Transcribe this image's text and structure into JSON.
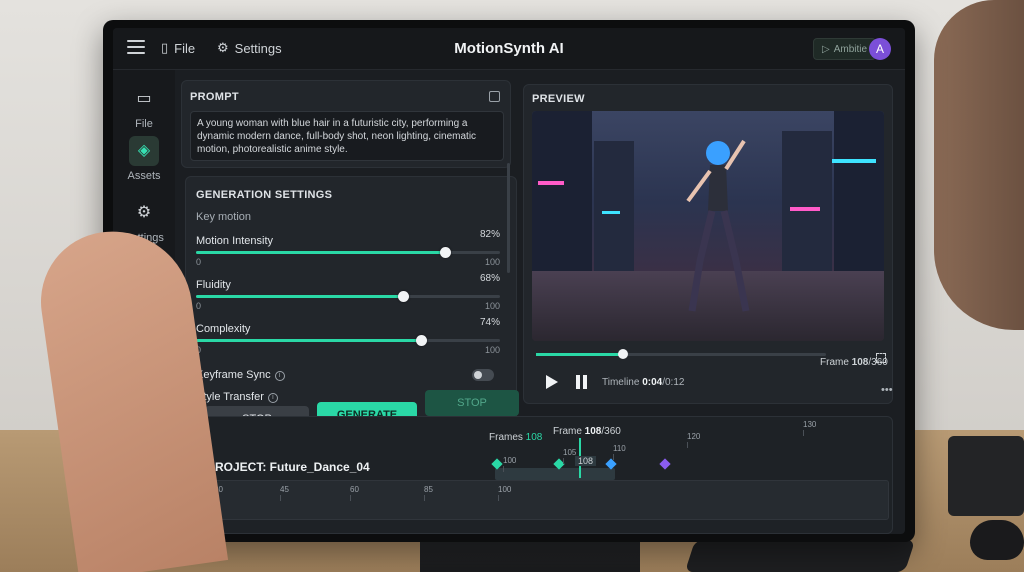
{
  "app": {
    "title": "MotionSynth AI",
    "menu_file": "File",
    "menu_settings": "Settings",
    "top_button": "Ambitie",
    "avatar_initial": "A"
  },
  "rail": {
    "items": [
      {
        "label": "File",
        "icon": "folder-icon"
      },
      {
        "label": "Assets",
        "icon": "cube-icon"
      },
      {
        "label": "Settings",
        "icon": "gear-icon"
      }
    ],
    "logout_icon": "logout-icon"
  },
  "prompt": {
    "title": "PROMPT",
    "text": "A young woman with blue hair in a futuristic city, performing a dynamic modern dance, full-body shot, neon lighting, cinematic motion, photorealistic anime style."
  },
  "generation": {
    "title": "GENERATION SETTINGS",
    "sub_label": "Key motion",
    "sliders": [
      {
        "label": "Motion Intensity",
        "value": 82,
        "value_text": "82%",
        "min": "0",
        "max": "100"
      },
      {
        "label": "Fluidity",
        "value": 68,
        "value_text": "68%",
        "min": "0",
        "max": "100"
      },
      {
        "label": "Complexity",
        "value": 74,
        "value_text": "74%",
        "min": "0",
        "max": "100"
      }
    ],
    "toggles": [
      {
        "label": "Keyframe Sync",
        "on": false
      },
      {
        "label": "Style Transfer",
        "on": false
      }
    ],
    "buttons": {
      "stop": "STOP",
      "generate": "GENERATE",
      "stop2": "STOP"
    }
  },
  "preview": {
    "title": "PREVIEW",
    "frame_current": "108",
    "frame_total": "/360",
    "frame_prefix": "Frame ",
    "timeline_label": "Timeline ",
    "timeline_current": "0:04",
    "timeline_total": "/0:12",
    "progress": 0.3
  },
  "project": {
    "title": "PROJECT: Future_Dance_04",
    "frames_label": "Frames ",
    "frames_value": "108",
    "frame_label": "Frame ",
    "frame_value": "108",
    "frame_total": "/360",
    "marker_label": "108",
    "ticks_top": [
      "100",
      "105",
      "110",
      "120",
      "130"
    ],
    "ticks_bottom": [
      "30",
      "45",
      "60",
      "85",
      "100"
    ]
  },
  "colors": {
    "accent": "#2ad8a6",
    "avatar": "#7b4fd8",
    "panel": "#22262b"
  }
}
